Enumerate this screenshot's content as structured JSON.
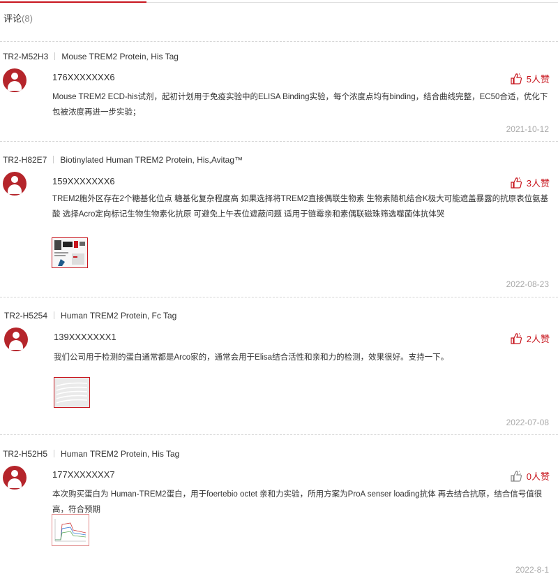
{
  "header": {
    "title": "评论",
    "count": "(8)"
  },
  "comments": [
    {
      "product_code": "TR2-M52H3",
      "product_name": "Mouse TREM2 Protein, His Tag",
      "user": "176XXXXXXX6",
      "likes": "5人赞",
      "text": "Mouse TREM2 ECD-his试剂，起初计划用于免疫实验中的ELISA Binding实验，每个浓度点均有binding，结合曲线完整，EC50合适，优化下包被浓度再进一步实验；",
      "date": "2021-10-12"
    },
    {
      "product_code": "TR2-H82E7",
      "product_name": "Biotinylated Human TREM2 Protein, His,Avitag™",
      "user": "159XXXXXXX6",
      "likes": "3人赞",
      "text": "TREM2胞外区存在2个糖基化位点 糖基化复杂程度高 如果选择将TREM2直接偶联生物素 生物素随机结合K极大可能遮盖暴露的抗原表位氨基酸 选择Acro定向标记生物生物素化抗原 可避免上午表位遮蔽问题 适用于链霉亲和素偶联磁珠筛选噬菌体抗体哭",
      "date": "2022-08-23",
      "image": "figure-thumbnail"
    },
    {
      "product_code": "TR2-H5254",
      "product_name": "Human TREM2 Protein, Fc Tag",
      "user": "139XXXXXXX1",
      "likes": "2人赞",
      "text": "我们公司用于检测的蛋白通常都是Arco家的，通常会用于Elisa结合活性和亲和力的检测，效果很好。支持一下。",
      "date": "2022-07-08",
      "image": "curve-thumbnail"
    },
    {
      "product_code": "TR2-H52H5",
      "product_name": "Human TREM2 Protein, His Tag",
      "user": "177XXXXXXX7",
      "likes": "0人赞",
      "text": "本次购买蛋白为 Human-TREM2蛋白，用于foertebio octet 亲和力实验，所用方案为ProA senser loading抗体 再去结合抗原，结合信号值很高，符合预期",
      "date": "2022-8-1",
      "image": "sensorgram-thumbnail"
    }
  ],
  "colors": {
    "accent": "#c8161e",
    "avatar": "#b5252b",
    "date": "#aaaaaa"
  },
  "icons": {
    "like": "thumbs-up-icon",
    "avatar": "user-avatar-icon"
  }
}
